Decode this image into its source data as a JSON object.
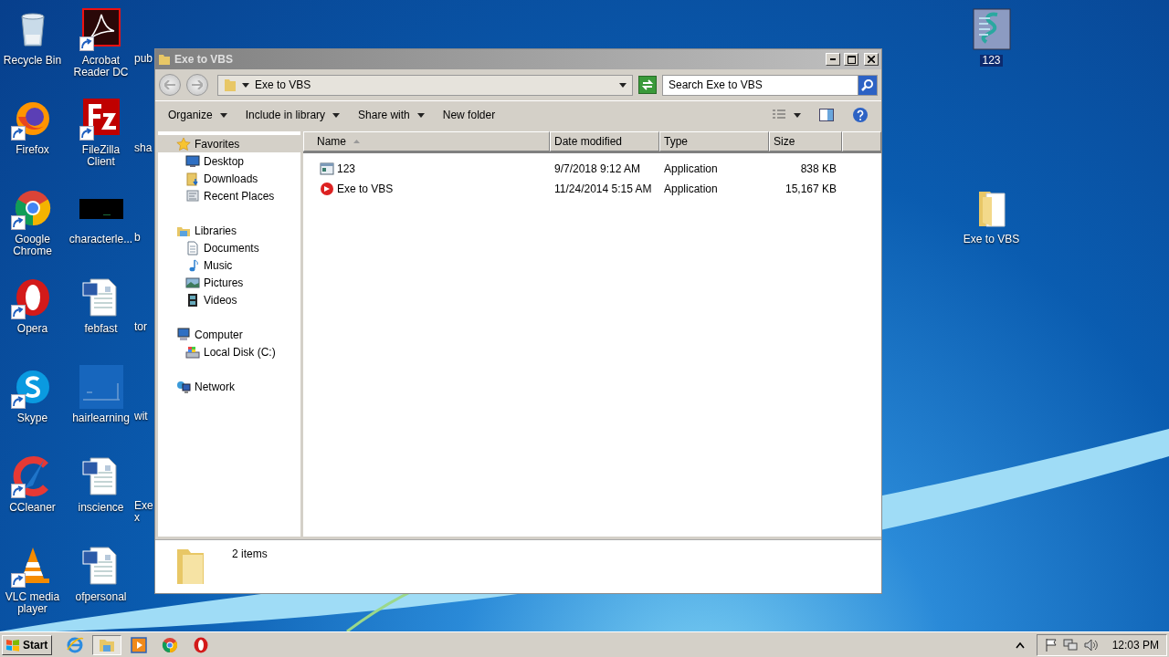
{
  "desktop": {
    "left_columns": [
      [
        {
          "label": "Recycle Bin",
          "kind": "recycle",
          "shortcut": false,
          "selected": false
        },
        {
          "label": "Firefox",
          "kind": "firefox",
          "shortcut": true,
          "selected": false
        },
        {
          "label": "Google Chrome",
          "kind": "chrome",
          "shortcut": true,
          "selected": false
        },
        {
          "label": "Opera",
          "kind": "opera",
          "shortcut": true,
          "selected": false
        },
        {
          "label": "Skype",
          "kind": "skype",
          "shortcut": true,
          "selected": false
        },
        {
          "label": "CCleaner",
          "kind": "ccleaner",
          "shortcut": true,
          "selected": false
        },
        {
          "label": "VLC media player",
          "kind": "vlc",
          "shortcut": true,
          "selected": false
        }
      ],
      [
        {
          "label": "Acrobat Reader DC",
          "kind": "acrobat",
          "shortcut": true,
          "selected": false
        },
        {
          "label": "FileZilla Client",
          "kind": "filezilla",
          "shortcut": true,
          "selected": false
        },
        {
          "label": "characterle...",
          "kind": "dark",
          "shortcut": false,
          "selected": false
        },
        {
          "label": "febfast",
          "kind": "word",
          "shortcut": false,
          "selected": false
        },
        {
          "label": "hairlearning",
          "kind": "faint",
          "shortcut": false,
          "selected": false
        },
        {
          "label": "inscience",
          "kind": "word",
          "shortcut": false,
          "selected": false
        },
        {
          "label": "ofpersonal",
          "kind": "word",
          "shortcut": false,
          "selected": false
        }
      ]
    ],
    "partly_hidden_labels": [
      "pub",
      "sha",
      "b",
      "tor",
      "wit",
      "Exe x"
    ],
    "right_icons": [
      {
        "label": "123",
        "kind": "script",
        "shortcut": false,
        "selected": true
      },
      {
        "label": "Exe to VBS",
        "kind": "folder",
        "shortcut": false,
        "selected": false
      }
    ]
  },
  "window": {
    "title": "Exe to VBS",
    "address": "Exe to VBS",
    "search": {
      "placeholder": "Search Exe to VBS"
    },
    "toolbar": [
      {
        "label": "Organize",
        "dropdown": true
      },
      {
        "label": "Include in library",
        "dropdown": true
      },
      {
        "label": "Share with",
        "dropdown": true
      },
      {
        "label": "New folder",
        "dropdown": false
      }
    ],
    "nav_tree": [
      {
        "label": "Favorites",
        "kind": "star",
        "selected": true,
        "children": [
          {
            "label": "Desktop",
            "kind": "monitor",
            "selected": false
          },
          {
            "label": "Downloads",
            "kind": "downloads",
            "selected": false
          },
          {
            "label": "Recent Places",
            "kind": "recent",
            "selected": false
          }
        ]
      },
      {
        "label": "Libraries",
        "kind": "library",
        "selected": false,
        "children": [
          {
            "label": "Documents",
            "kind": "document",
            "selected": false
          },
          {
            "label": "Music",
            "kind": "music",
            "selected": false
          },
          {
            "label": "Pictures",
            "kind": "pictures",
            "selected": false
          },
          {
            "label": "Videos",
            "kind": "videos",
            "selected": false
          }
        ]
      },
      {
        "label": "Computer",
        "kind": "computer",
        "selected": false,
        "children": [
          {
            "label": "Local Disk (C:)",
            "kind": "disk",
            "selected": false
          }
        ]
      },
      {
        "label": "Network",
        "kind": "network",
        "selected": false
      }
    ],
    "columns": [
      {
        "label": "Name",
        "sorted": true
      },
      {
        "label": "Date modified",
        "sorted": false
      },
      {
        "label": "Type",
        "sorted": false
      },
      {
        "label": "Size",
        "sorted": false
      }
    ],
    "files": [
      {
        "kind": "window-app",
        "name": "123",
        "date": "9/7/2018 9:12 AM",
        "type": "Application",
        "size": "838 KB"
      },
      {
        "kind": "red-app",
        "name": "Exe to VBS",
        "date": "11/24/2014 5:15 AM",
        "type": "Application",
        "size": "15,167 KB"
      }
    ],
    "status": "2 items"
  },
  "taskbar": {
    "start": "Start",
    "apps": [
      {
        "kind": "ie",
        "active": false
      },
      {
        "kind": "explorer",
        "active": true
      },
      {
        "kind": "player",
        "active": false
      },
      {
        "kind": "chrome",
        "active": false
      },
      {
        "kind": "opera",
        "active": false
      }
    ],
    "clock": "12:03 PM"
  }
}
